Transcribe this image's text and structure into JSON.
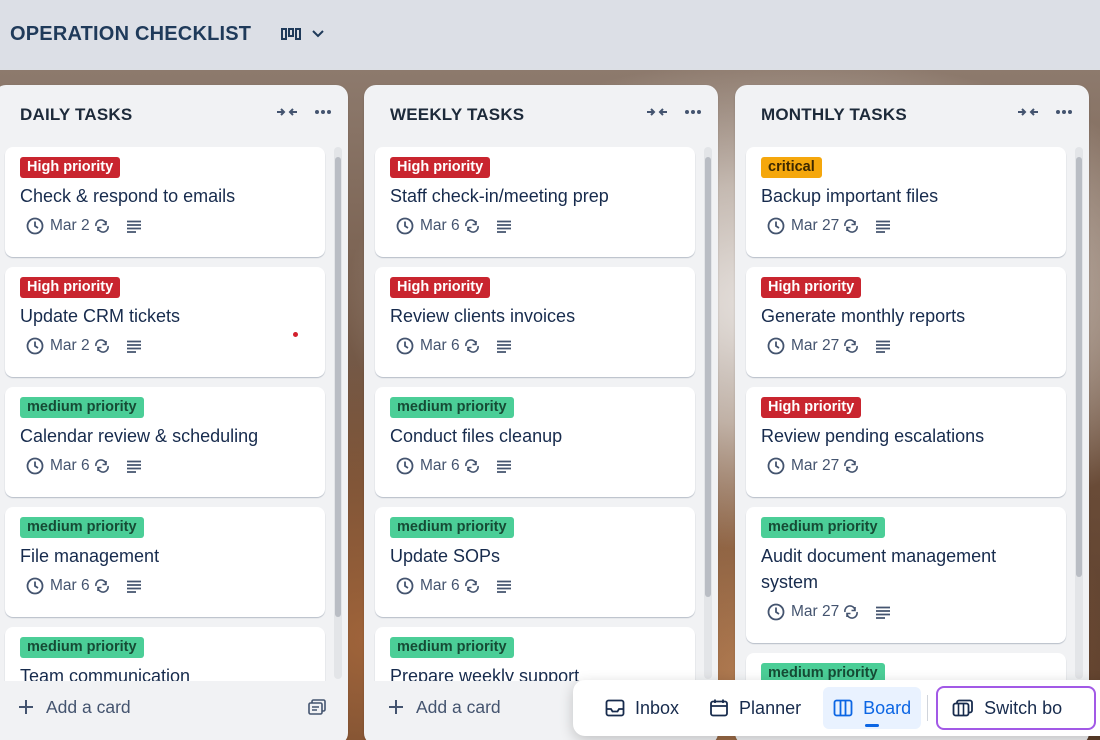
{
  "header": {
    "title": "OPERATION CHECKLIST"
  },
  "lists": [
    {
      "title": "DAILY TASKS",
      "add_card_label": "Add a card",
      "cards": [
        {
          "label": "High priority",
          "label_type": "high",
          "title": "Check & respond to emails",
          "date": "Mar 2"
        },
        {
          "label": "High priority",
          "label_type": "high",
          "title": "Update CRM tickets",
          "date": "Mar 2"
        },
        {
          "label": "medium priority",
          "label_type": "medium",
          "title": "Calendar review & scheduling",
          "date": "Mar 6"
        },
        {
          "label": "medium priority",
          "label_type": "medium",
          "title": "File management",
          "date": "Mar 6"
        },
        {
          "label": "medium priority",
          "label_type": "medium",
          "title": "Team communication",
          "date": ""
        }
      ]
    },
    {
      "title": "WEEKLY TASKS",
      "add_card_label": "Add a card",
      "cards": [
        {
          "label": "High priority",
          "label_type": "high",
          "title": "Staff check-in/meeting prep",
          "date": "Mar 6"
        },
        {
          "label": "High priority",
          "label_type": "high",
          "title": "Review clients invoices",
          "date": "Mar 6"
        },
        {
          "label": "medium priority",
          "label_type": "medium",
          "title": "Conduct files cleanup",
          "date": "Mar 6"
        },
        {
          "label": "medium priority",
          "label_type": "medium",
          "title": "Update SOPs",
          "date": "Mar 6"
        },
        {
          "label": "medium priority",
          "label_type": "medium",
          "title": "Prepare weekly support",
          "date": ""
        }
      ]
    },
    {
      "title": "MONTHLY TASKS",
      "cards": [
        {
          "label": "critical",
          "label_type": "critical",
          "title": "Backup important files",
          "date": "Mar 27"
        },
        {
          "label": "High priority",
          "label_type": "high",
          "title": "Generate monthly reports",
          "date": "Mar 27"
        },
        {
          "label": "High priority",
          "label_type": "high",
          "title": "Review pending escalations",
          "date": "Mar 27"
        },
        {
          "label": "medium priority",
          "label_type": "medium",
          "title": "Audit document management system",
          "date": "Mar 27"
        },
        {
          "label": "medium priority",
          "label_type": "medium",
          "title": "",
          "date": ""
        }
      ]
    }
  ],
  "bottom_nav": {
    "inbox": "Inbox",
    "planner": "Planner",
    "board": "Board",
    "switch": "Switch bo"
  },
  "colors": {
    "high": "#c9252f",
    "medium": "#4bce97",
    "critical": "#f5a70c",
    "active_nav": "#0c66e4",
    "switch_border": "#a259e6"
  }
}
